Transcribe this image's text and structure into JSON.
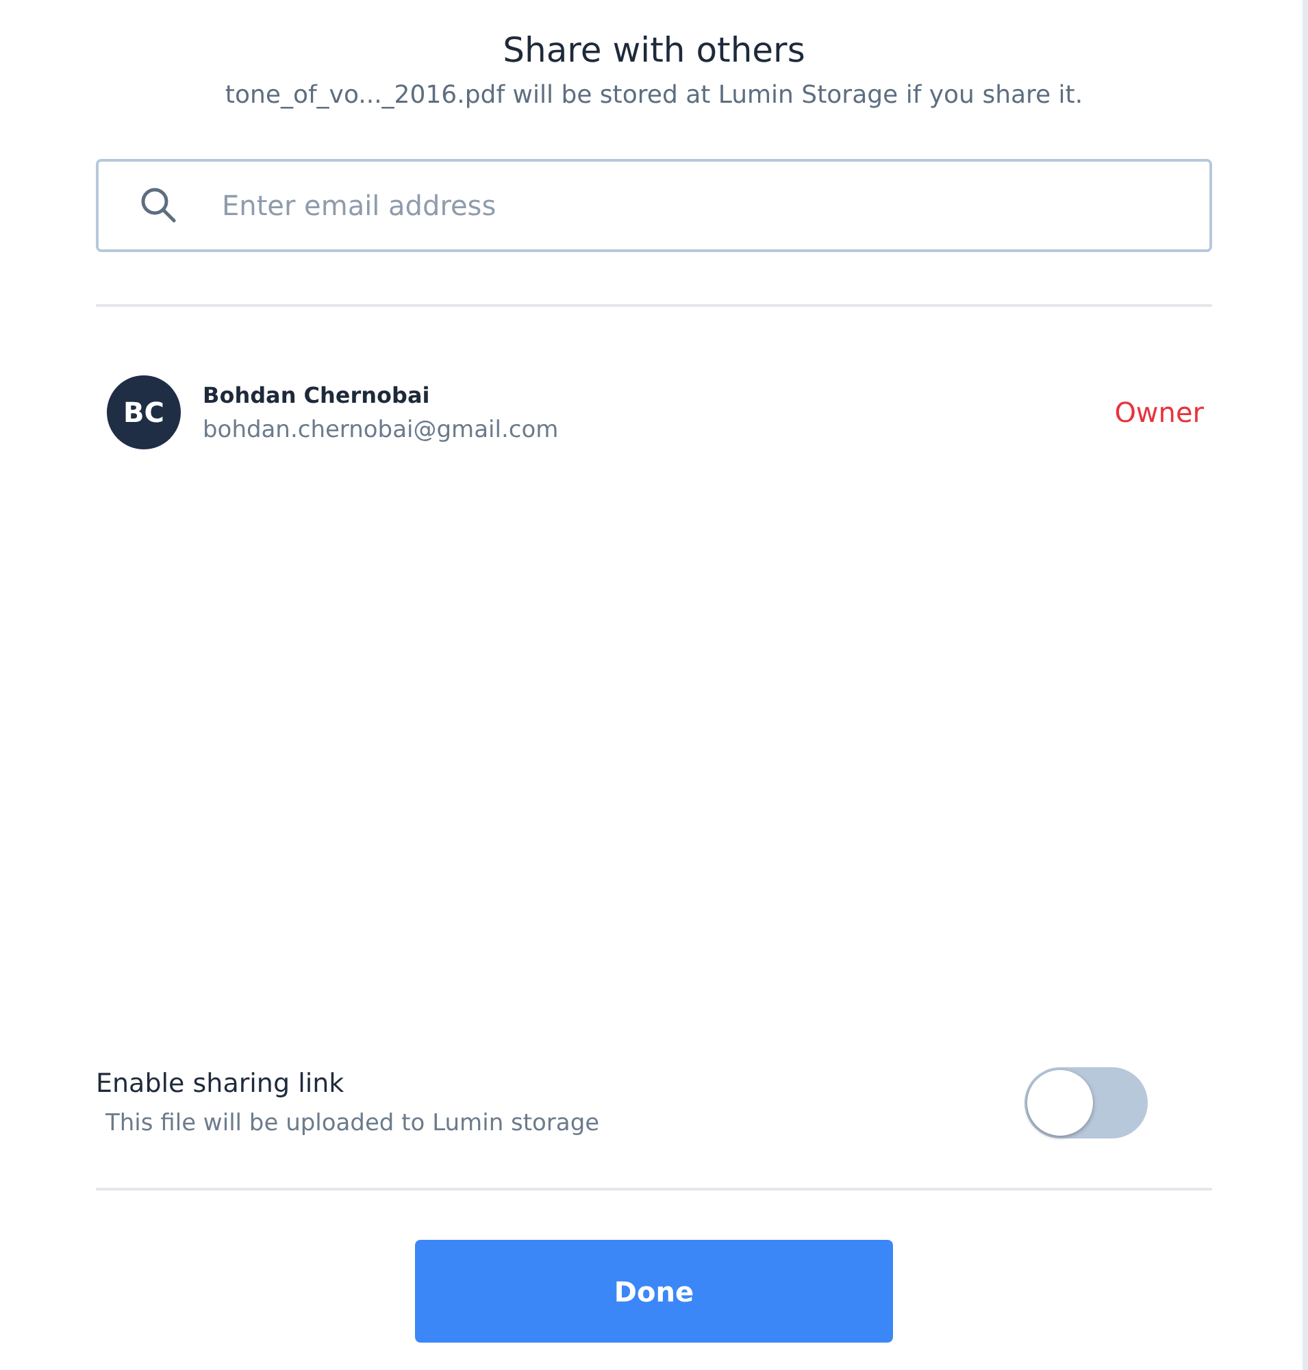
{
  "dialog": {
    "title": "Share with others",
    "subtitle": "tone_of_vo..._2016.pdf will be stored at Lumin Storage if you share it."
  },
  "search": {
    "placeholder": "Enter email address"
  },
  "members": [
    {
      "initials": "BC",
      "name": "Bohdan Chernobai",
      "email": "bohdan.chernobai@gmail.com",
      "role": "Owner"
    }
  ],
  "sharing_link": {
    "label": "Enable sharing link",
    "hint": "This file will be uploaded to Lumin storage",
    "on": false
  },
  "buttons": [
    "Done"
  ]
}
